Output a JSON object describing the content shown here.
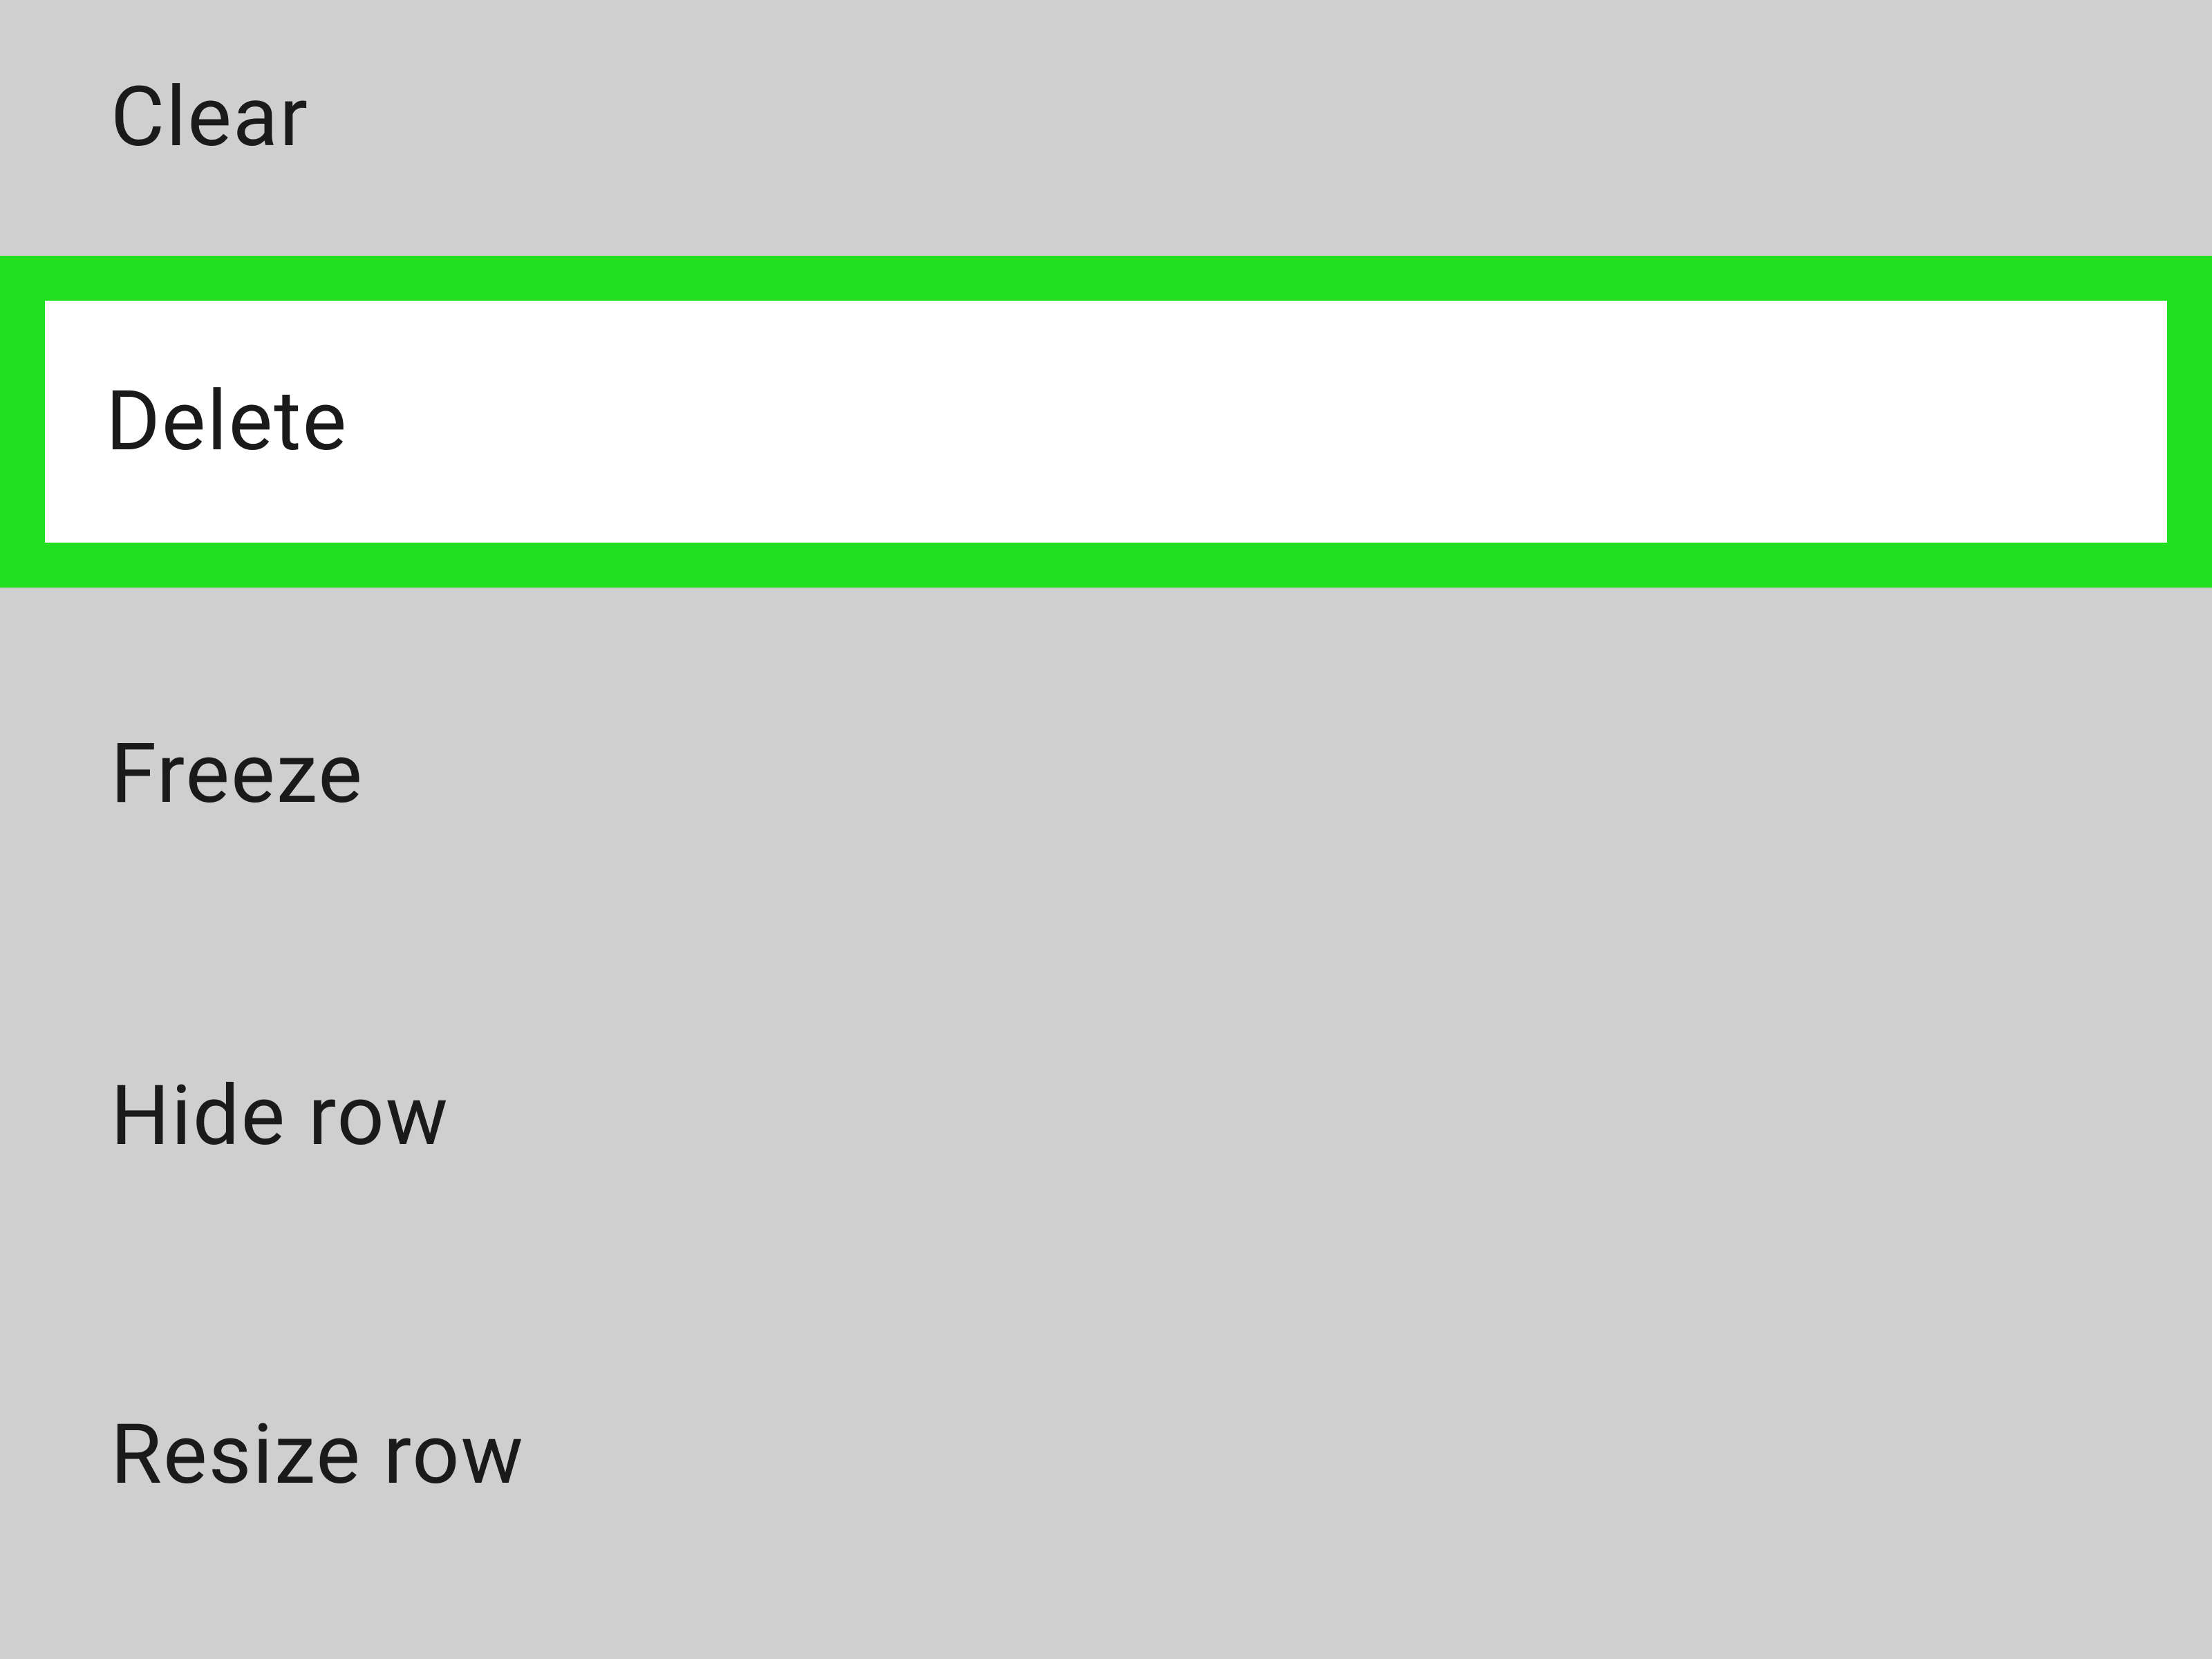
{
  "menu": {
    "items": [
      {
        "label": "Clear"
      },
      {
        "label": "Delete"
      },
      {
        "label": "Freeze"
      },
      {
        "label": "Hide row"
      },
      {
        "label": "Resize row"
      }
    ],
    "highlight_color": "#22e01f",
    "background_color": "#cfcfcf"
  }
}
